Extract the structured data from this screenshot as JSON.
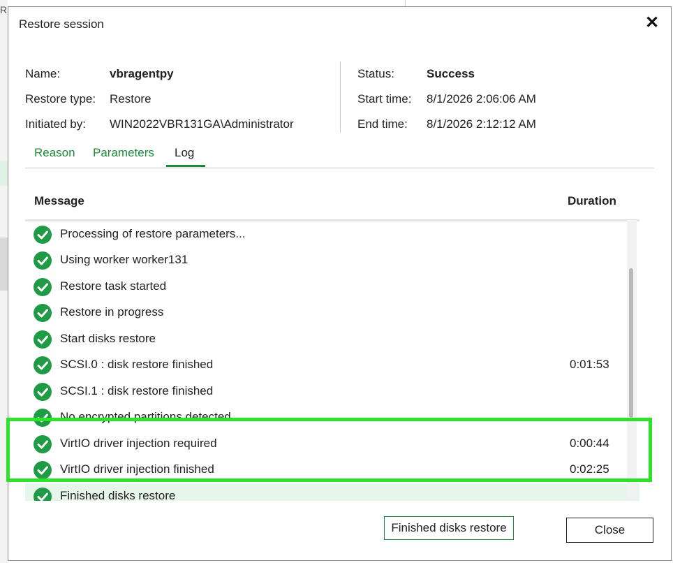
{
  "background": {
    "edge_letter": "R"
  },
  "dialog": {
    "title": "Restore session"
  },
  "info": {
    "name_label": "Name:",
    "name_value": "vbragentpy",
    "restore_type_label": "Restore type:",
    "restore_type_value": "Restore",
    "initiated_label": "Initiated by:",
    "initiated_value": "WIN2022VBR131GA\\Administrator",
    "status_label": "Status:",
    "status_value": "Success",
    "start_label": "Start time:",
    "start_value": "8/1/2026 2:06:06 AM",
    "end_label": "End time:",
    "end_value": "8/1/2026 2:12:12 AM"
  },
  "tabs": [
    {
      "label": "Reason"
    },
    {
      "label": "Parameters"
    },
    {
      "label": "Log",
      "active": true
    }
  ],
  "log": {
    "columns": {
      "message": "Message",
      "duration": "Duration"
    },
    "rows": [
      {
        "message": "Processing of restore parameters...",
        "duration": ""
      },
      {
        "message": "Using worker worker131",
        "duration": ""
      },
      {
        "message": "Restore task started",
        "duration": ""
      },
      {
        "message": "Restore in progress",
        "duration": ""
      },
      {
        "message": "Start disks restore",
        "duration": ""
      },
      {
        "message": "SCSI.0 : disk restore finished",
        "duration": "0:01:53"
      },
      {
        "message": "SCSI.1 : disk restore finished",
        "duration": ""
      },
      {
        "message": "No encrypted partitions detected",
        "duration": ""
      },
      {
        "message": "VirtIO driver injection required",
        "duration": "0:00:44"
      },
      {
        "message": "VirtIO driver injection finished",
        "duration": "0:02:25"
      },
      {
        "message": "Finished disks restore",
        "duration": "",
        "selected": true
      }
    ]
  },
  "footer": {
    "status_text": "Finished disks restore",
    "close_label": "Close"
  },
  "colors": {
    "accent_green": "#1d8a3a",
    "success_icon": "#1f9b46",
    "highlight_box": "#2de22a"
  }
}
